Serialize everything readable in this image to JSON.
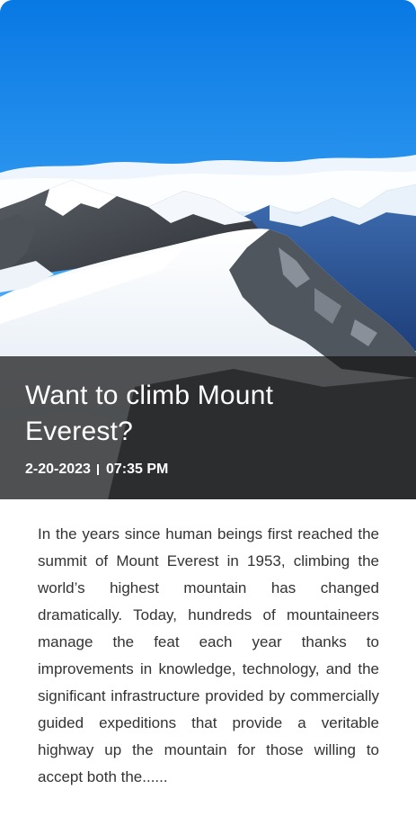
{
  "article": {
    "hero_image": "snowy-mountain-range-photo",
    "title": "Want to climb Mount Everest?",
    "date": "2-20-2023",
    "time": "07:35 PM",
    "body": "In the years since human beings first reached the summit of Mount Everest in 1953, climbing the world’s highest mountain has changed dramatically. Today, hundreds of mountaineers manage the feat each year thanks to improvements in knowledge, technology, and the significant infrastructure provided by commercially guided expeditions that provide a veritable highway up the mountain for those willing to accept both the......"
  },
  "colors": {
    "sky_top": "#0b7de6",
    "sky_bottom": "#a8d6fb",
    "overlay": "#141414",
    "text": "#333333"
  }
}
